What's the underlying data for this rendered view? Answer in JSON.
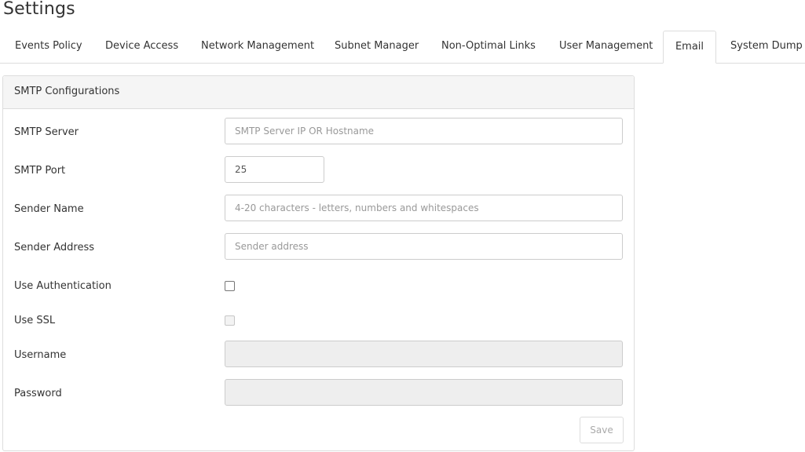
{
  "page": {
    "title": "Settings"
  },
  "tabs": [
    {
      "label": "Events Policy",
      "active": false
    },
    {
      "label": "Device Access",
      "active": false
    },
    {
      "label": "Network Management",
      "active": false
    },
    {
      "label": "Subnet Manager",
      "active": false
    },
    {
      "label": "Non-Optimal Links",
      "active": false
    },
    {
      "label": "User Management",
      "active": false
    },
    {
      "label": "Email",
      "active": true
    },
    {
      "label": "System Dump",
      "active": false
    }
  ],
  "smtp": {
    "heading": "SMTP Configurations",
    "server": {
      "label": "SMTP Server",
      "value": "",
      "placeholder": "SMTP Server IP OR Hostname"
    },
    "port": {
      "label": "SMTP Port",
      "value": "25",
      "placeholder": ""
    },
    "sender_name": {
      "label": "Sender Name",
      "value": "",
      "placeholder": "4-20 characters - letters, numbers and whitespaces"
    },
    "sender_address": {
      "label": "Sender Address",
      "value": "",
      "placeholder": "Sender address"
    },
    "use_authentication": {
      "label": "Use Authentication",
      "checked": false,
      "disabled": false
    },
    "use_ssl": {
      "label": "Use SSL",
      "checked": false,
      "disabled": true
    },
    "username": {
      "label": "Username",
      "value": "",
      "disabled": true
    },
    "password": {
      "label": "Password",
      "value": "",
      "disabled": true
    },
    "save_label": "Save"
  }
}
